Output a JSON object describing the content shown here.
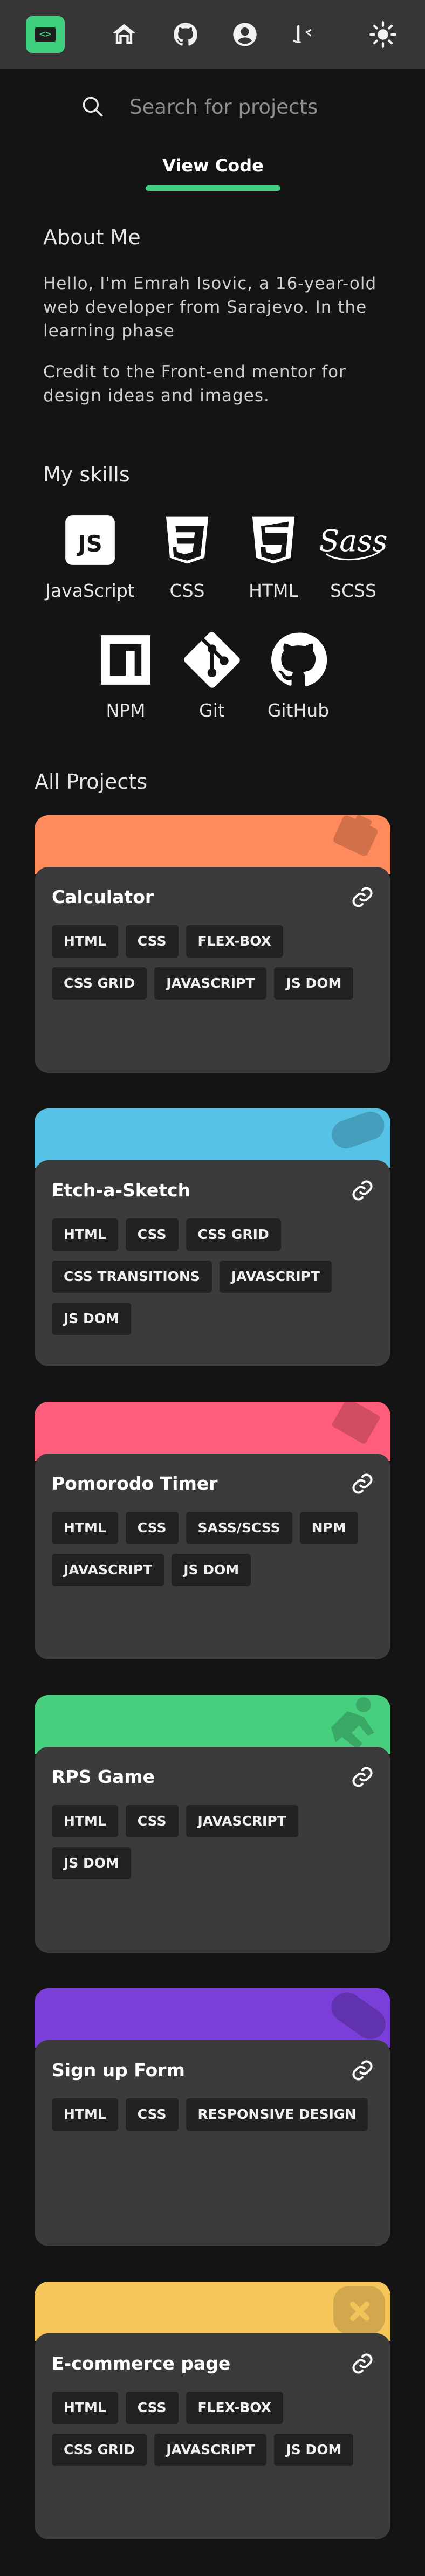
{
  "header": {
    "logo_text": "<>",
    "icons": [
      "home-icon",
      "github-icon",
      "profile-icon",
      "code-view-icon",
      "theme-toggle-sun-icon"
    ]
  },
  "search": {
    "placeholder": "Search for projects"
  },
  "tab": {
    "label": "View Code"
  },
  "about": {
    "title": "About Me",
    "paragraph1": "Hello, I'm Emrah Isovic, a 16-year-old web developer from Sarajevo. In the learning phase",
    "paragraph2": "Credit to the Front-end mentor for design ideas and images."
  },
  "skills": {
    "title": "My skills",
    "items": [
      {
        "label": "JavaScript",
        "icon": "javascript-icon"
      },
      {
        "label": "CSS",
        "icon": "css-icon"
      },
      {
        "label": "HTML",
        "icon": "html-icon"
      },
      {
        "label": "SCSS",
        "icon": "sass-icon"
      },
      {
        "label": "NPM",
        "icon": "npm-icon"
      },
      {
        "label": "Git",
        "icon": "git-icon"
      },
      {
        "label": "GitHub",
        "icon": "github-icon"
      }
    ]
  },
  "projects": {
    "title": "All Projects",
    "items": [
      {
        "name": "Calculator",
        "color": "#ff8a5c",
        "deco": "work-icon",
        "tags": [
          "HTML",
          "CSS",
          "FLEX-BOX",
          "CSS GRID",
          "JAVASCRIPT",
          "JS DOM"
        ]
      },
      {
        "name": "Etch-a-Sketch",
        "color": "#55c2e6",
        "deco": "gamepad-icon",
        "tags": [
          "HTML",
          "CSS",
          "CSS GRID",
          "CSS TRANSITIONS",
          "JAVASCRIPT",
          "JS DOM"
        ]
      },
      {
        "name": "Pomorodo Timer",
        "color": "#ff5e7b",
        "deco": "book-icon",
        "tags": [
          "HTML",
          "CSS",
          "SASS/SCSS",
          "NPM",
          "JAVASCRIPT",
          "JS DOM"
        ]
      },
      {
        "name": "RPS Game",
        "color": "#47cf7f",
        "deco": "running-icon",
        "tags": [
          "HTML",
          "CSS",
          "JAVASCRIPT",
          "JS DOM"
        ]
      },
      {
        "name": "Sign up Form",
        "color": "#7a3fd9",
        "deco": "gamepad-icon",
        "tags": [
          "HTML",
          "CSS",
          "RESPONSIVE DESIGN"
        ]
      },
      {
        "name": "E-commerce page",
        "color": "#f6c65b",
        "deco": "care-icon",
        "tags": [
          "HTML",
          "CSS",
          "FLEX-BOX",
          "CSS GRID",
          "JAVASCRIPT",
          "JS DOM"
        ]
      }
    ]
  }
}
